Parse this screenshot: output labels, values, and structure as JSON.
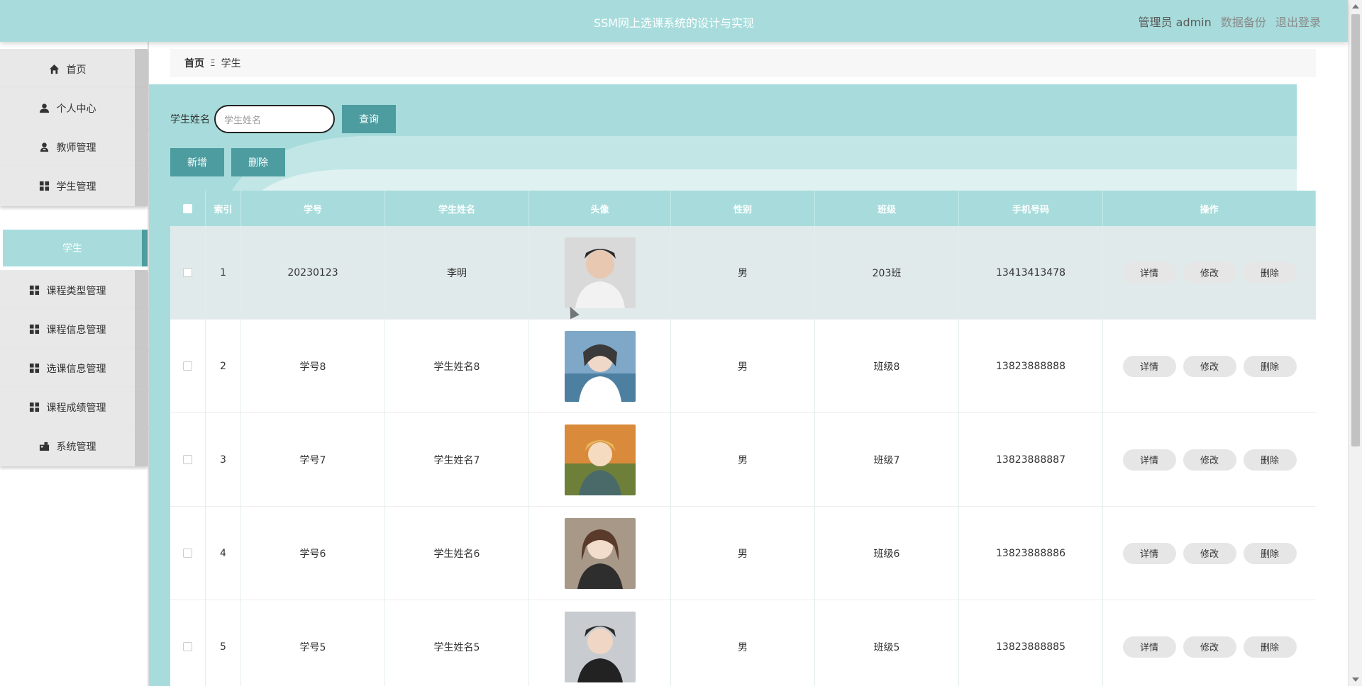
{
  "header": {
    "title": "SSM网上选课系统的设计与实现",
    "role": "管理员 admin",
    "backup": "数据备份",
    "logout": "退出登录"
  },
  "sidebar": {
    "items": [
      {
        "label": "首页",
        "icon": "home-icon"
      },
      {
        "label": "个人中心",
        "icon": "user-icon"
      },
      {
        "label": "教师管理",
        "icon": "teacher-icon"
      },
      {
        "label": "学生管理",
        "icon": "grid-icon"
      },
      {
        "label": "课程类型管理",
        "icon": "grid-icon"
      },
      {
        "label": "课程信息管理",
        "icon": "grid-icon"
      },
      {
        "label": "选课信息管理",
        "icon": "grid-icon"
      },
      {
        "label": "课程成绩管理",
        "icon": "grid-icon"
      },
      {
        "label": "系统管理",
        "icon": "system-icon"
      }
    ],
    "submenu": {
      "label": "学生"
    }
  },
  "breadcrumb": {
    "home": "首页",
    "separator": "Ξ",
    "current": "学生"
  },
  "search": {
    "label": "学生姓名",
    "placeholder": "学生姓名",
    "button": "查询"
  },
  "actions": {
    "add": "新增",
    "delete": "删除"
  },
  "table": {
    "headers": [
      "索引",
      "学号",
      "学生姓名",
      "头像",
      "性别",
      "班级",
      "手机号码",
      "操作"
    ],
    "rows": [
      {
        "index": "1",
        "student_no": "20230123",
        "name": "李明",
        "gender": "男",
        "class": "203班",
        "phone": "13413413478"
      },
      {
        "index": "2",
        "student_no": "学号8",
        "name": "学生姓名8",
        "gender": "男",
        "class": "班级8",
        "phone": "13823888888"
      },
      {
        "index": "3",
        "student_no": "学号7",
        "name": "学生姓名7",
        "gender": "男",
        "class": "班级7",
        "phone": "13823888887"
      },
      {
        "index": "4",
        "student_no": "学号6",
        "name": "学生姓名6",
        "gender": "男",
        "class": "班级6",
        "phone": "13823888886"
      },
      {
        "index": "5",
        "student_no": "学号5",
        "name": "学生姓名5",
        "gender": "男",
        "class": "班级5",
        "phone": "13823888885"
      }
    ],
    "ops": {
      "detail": "详情",
      "edit": "修改",
      "delete": "删除"
    }
  },
  "colors": {
    "primary": "#a8dcdc",
    "accent": "#4c9ca0",
    "highlight_row": "#e0eaea"
  }
}
